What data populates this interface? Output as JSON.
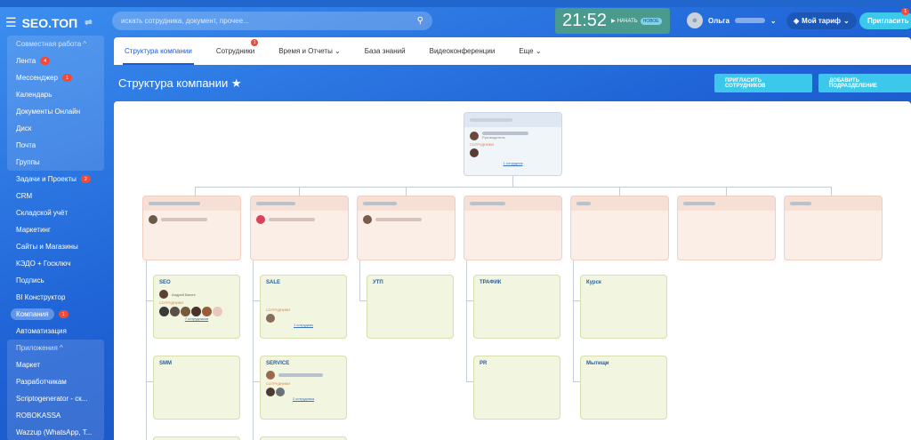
{
  "header": {
    "logo": "SEO.ТОП",
    "search_placeholder": "искать сотрудника, документ, прочее...",
    "clock": "21:52",
    "start": "НАЧАТЬ",
    "new_badge": "НОВОЕ",
    "user": "Ольга",
    "tariff": "Мой тариф",
    "invite": "Пригласить",
    "invite_count": "1"
  },
  "sidebar": {
    "group1": "Совместная работа ^",
    "g1": [
      {
        "label": "Лента",
        "badge": "4"
      },
      {
        "label": "Мессенджер",
        "badge": "1"
      },
      {
        "label": "Календарь",
        "badge": ""
      },
      {
        "label": "Документы Онлайн",
        "badge": ""
      },
      {
        "label": "Диск",
        "badge": ""
      },
      {
        "label": "Почта",
        "badge": ""
      },
      {
        "label": "Группы",
        "badge": ""
      }
    ],
    "items": [
      {
        "label": "Задачи и Проекты",
        "badge": "2"
      },
      {
        "label": "CRM",
        "badge": ""
      },
      {
        "label": "Складской учёт",
        "badge": ""
      },
      {
        "label": "Маркетинг",
        "badge": ""
      },
      {
        "label": "Сайты и Магазины",
        "badge": ""
      },
      {
        "label": "КЭДО + Госключ",
        "badge": ""
      },
      {
        "label": "Подпись",
        "badge": ""
      },
      {
        "label": "BI Конструктор",
        "badge": ""
      },
      {
        "label": "Компания",
        "badge": "1"
      },
      {
        "label": "Автоматизация",
        "badge": ""
      }
    ],
    "group2": "Приложения ^",
    "g2": [
      {
        "label": "Маркет"
      },
      {
        "label": "Разработчикам"
      },
      {
        "label": "Scriptogenerator - ск..."
      },
      {
        "label": "ROBOKASSA"
      },
      {
        "label": "Wazzup (WhatsApp, T..."
      }
    ]
  },
  "tabs": [
    "Структура компании",
    "Сотрудники",
    "Время и Отчеты ⌄",
    "База знаний",
    "Видеоконференции",
    "Еще ⌄"
  ],
  "tab_badge": "1",
  "page": {
    "title": "Структура компании ★",
    "invite_btn": "ПРИГЛАСИТЬ СОТРУДНИКОВ",
    "add_btn": "ДОБАВИТЬ ПОДРАЗДЕЛЕНИЕ"
  },
  "org": {
    "root_role": "Руководитель",
    "root_employees": "СОТРУДНИКИ",
    "root_link": "1 сотрудник",
    "teams": {
      "seo": "SEO",
      "smm": "SMM",
      "sale": "SALE",
      "service": "SERVICE",
      "utp": "УТП",
      "traffic": "ТРАФИК",
      "pr": "PR",
      "kursk": "Курск",
      "mytishchi": "Мытищи"
    },
    "seo_person": "Андрей Валее",
    "employees_label": "СОТРУДНИКИ",
    "seo_link": "7 сотрудников",
    "sale_link": "1 сотрудник",
    "service_link": "2 сотрудника"
  }
}
